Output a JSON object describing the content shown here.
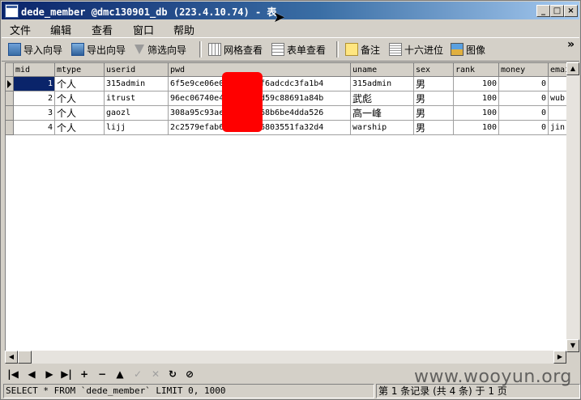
{
  "window": {
    "title": "dede_member @dmc130901_db (223.4.10.74) - 表",
    "controls": [
      "_",
      "□",
      "×"
    ]
  },
  "menu": [
    "文件",
    "编辑",
    "查看",
    "窗口",
    "帮助"
  ],
  "toolbar": {
    "import": "导入向导",
    "export": "导出向导",
    "filter": "筛选向导",
    "grid_view": "网格查看",
    "form_view": "表单查看",
    "memo": "备注",
    "hex": "十六进位",
    "image": "图像",
    "more": "»"
  },
  "table": {
    "columns": [
      "mid",
      "mtype",
      "userid",
      "pwd",
      "uname",
      "sex",
      "rank",
      "money",
      "email"
    ],
    "rows": [
      [
        "1",
        "个人",
        "315admin",
        "6f5e9ce06e0",
        "f6adcdc3fa1b4",
        "315admin",
        "男",
        "100",
        "0",
        ""
      ],
      [
        "2",
        "个人",
        "itrust",
        "96ec06740e4",
        "d59c88691a84b",
        "武彪",
        "男",
        "100",
        "0",
        "wub"
      ],
      [
        "3",
        "个人",
        "gaozl",
        "308a95c93ae",
        "68b6be4dda526",
        "高一峰",
        "男",
        "100",
        "0",
        ""
      ],
      [
        "4",
        "个人",
        "lijj",
        "2c2579efab6",
        "6803551fa32d4",
        "warship",
        "男",
        "100",
        "0",
        "jin"
      ]
    ]
  },
  "nav_buttons": [
    "|◀",
    "◀",
    "▶",
    "▶|",
    "+",
    "−",
    "▲",
    "✓",
    "✕",
    "↻",
    "⊘"
  ],
  "status": {
    "sql": "SELECT * FROM `dede_member` LIMIT 0, 1000",
    "record": "第 1 条记录 (共 4 条) 于 1 页"
  },
  "watermark": "www.wooyun.org",
  "colors": {
    "title_gradient_start": "#0a246a",
    "selected_cell": "#0a246a",
    "redaction": "#ff0000"
  }
}
